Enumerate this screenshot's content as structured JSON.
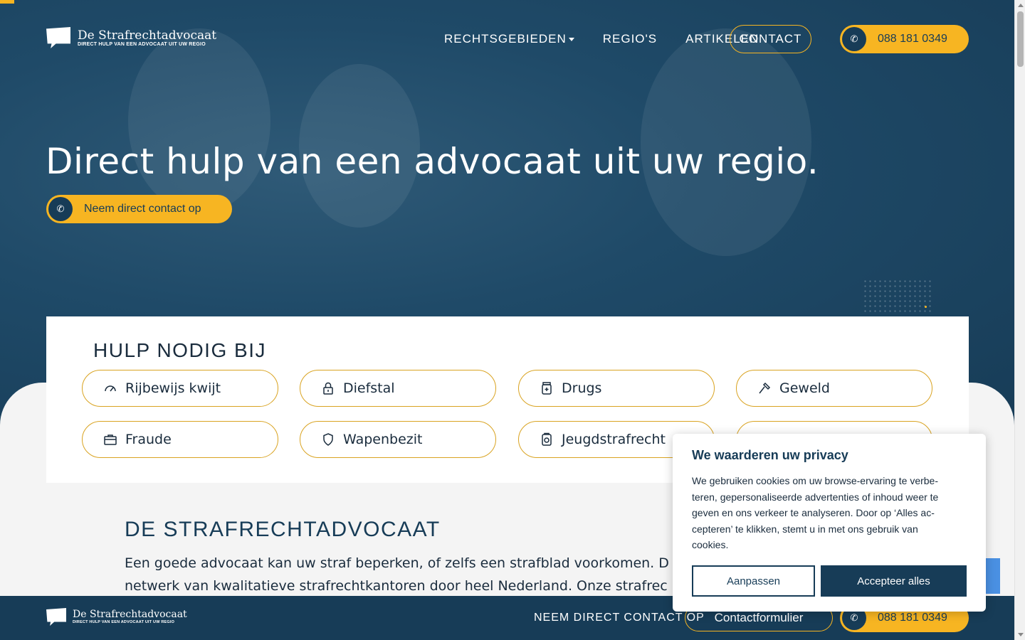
{
  "brand": {
    "name": "De Strafrechtadvocaat",
    "tagline": "DIRECT HULP VAN EEN ADVOCAAT UIT UW REGIO"
  },
  "nav": {
    "items": [
      "RECHTSGEBIEDEN",
      "REGIO'S",
      "ARTIKELEN"
    ],
    "contact": "CONTACT",
    "phone": "088 181 0349"
  },
  "hero": {
    "title": "Direct hulp van een advocaat uit uw regio.",
    "cta": "Neem direct contact op"
  },
  "help": {
    "title": "HULP NODIG BIJ",
    "items": [
      {
        "label": "Rijbewijs kwijt",
        "icon": "speedometer-icon"
      },
      {
        "label": "Diefstal",
        "icon": "lock-icon"
      },
      {
        "label": "Drugs",
        "icon": "pill-jar-icon"
      },
      {
        "label": "Geweld",
        "icon": "hammer-icon"
      },
      {
        "label": "Fraude",
        "icon": "briefcase-icon"
      },
      {
        "label": "Wapenbezit",
        "icon": "shield-icon"
      },
      {
        "label": "Jeugdstrafrecht",
        "icon": "child-badge-icon"
      }
    ]
  },
  "about": {
    "title": "DE STRAFRECHTADVOCAAT",
    "line1": "Een goede advocaat kan uw straf beperken, of zelfs een strafblad voorkomen. D",
    "line2": "netwerk van kwalitatieve strafrechtkantoren door heel Nederland. Onze strafrec"
  },
  "footer_bar": {
    "contact_text": "NEEM DIRECT CONTACT OP",
    "form_button": "Contactformulier",
    "phone": "088 181 0349"
  },
  "cookie": {
    "title": "We waarderen uw privacy",
    "line1": "We gebruiken cookies om uw browse-ervaring te verbe-",
    "line2": "teren, gepersonaliseerde advertenties of inhoud weer te",
    "line3": "geven en ons verkeer te analyseren. Door op ‘Alles ac-",
    "line4": "cepteren’ te klikken, stemt u in met ons gebruik van",
    "line5": "cookies.",
    "customize": "Aanpassen",
    "accept": "Accepteer alles"
  },
  "colors": {
    "navy": "#173c57",
    "accent": "#f7b522",
    "background": "#f4f4f4"
  }
}
